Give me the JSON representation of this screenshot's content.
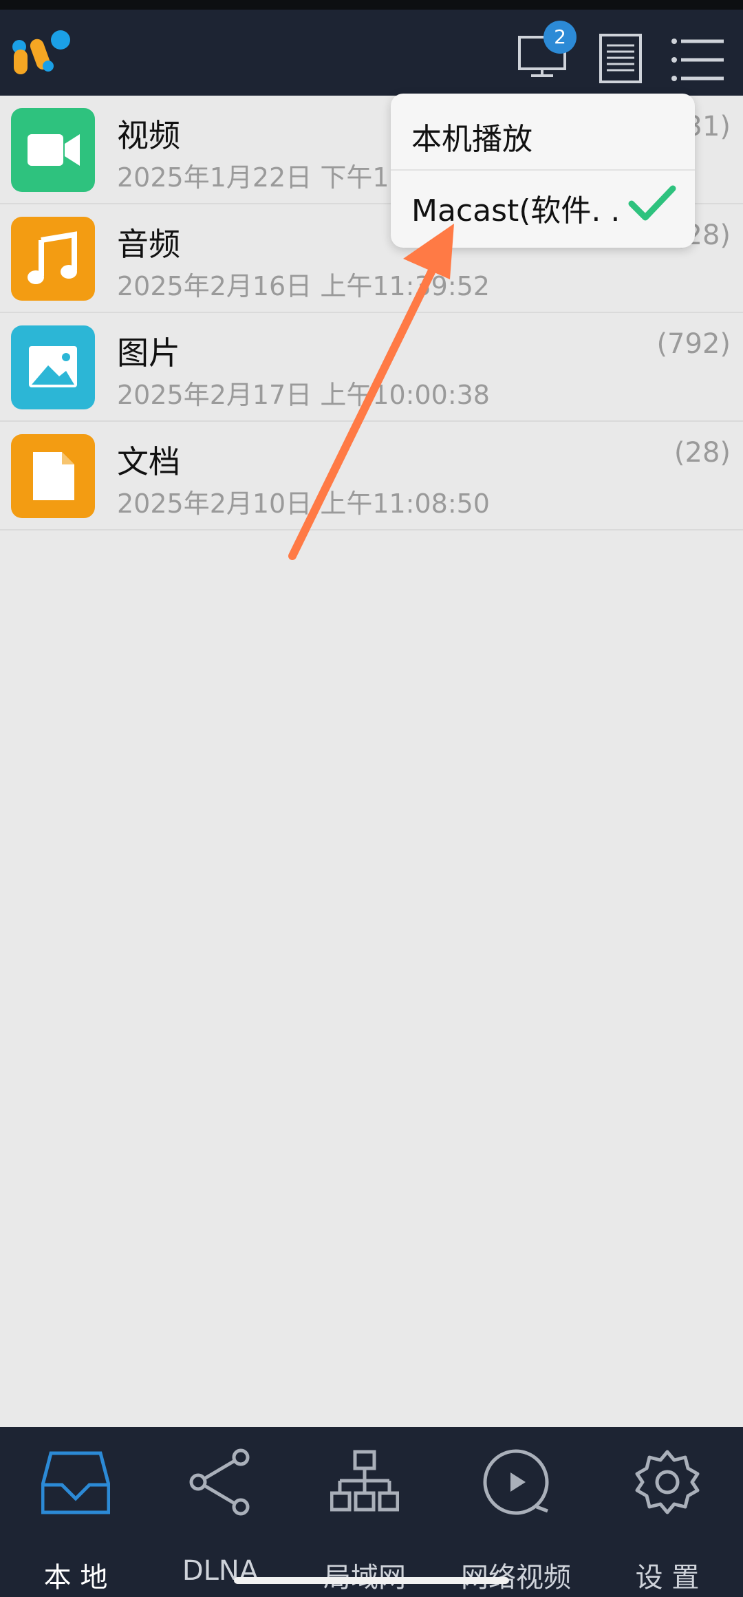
{
  "header": {
    "cast_badge": "2"
  },
  "categories": [
    {
      "name": "视频",
      "date": "2025年1月22日 下午10:07:18",
      "count": "(31)",
      "color": "#2ec27e",
      "icon": "video-camera-icon"
    },
    {
      "name": "音频",
      "date": "2025年2月16日 上午11:39:52",
      "count": "(28)",
      "color": "#f39c12",
      "icon": "music-note-icon"
    },
    {
      "name": "图片",
      "date": "2025年2月17日 上午10:00:38",
      "count": "(792)",
      "color": "#2cb6d6",
      "icon": "image-icon"
    },
    {
      "name": "文档",
      "date": "2025年2月10日 上午11:08:50",
      "count": "(28)",
      "color": "#f39c12",
      "icon": "document-icon"
    }
  ],
  "popup": {
    "option_local": "本机播放",
    "option_macast": "Macast(软件. .",
    "selected": "option_macast"
  },
  "tabs": [
    {
      "label": "本 地",
      "icon": "inbox-icon",
      "active": true
    },
    {
      "label": "DLNA",
      "icon": "share-icon",
      "active": false
    },
    {
      "label": "局域网",
      "icon": "network-icon",
      "active": false
    },
    {
      "label": "网络视频",
      "icon": "play-circle-icon",
      "active": false
    },
    {
      "label": "设 置",
      "icon": "gear-icon",
      "active": false
    }
  ],
  "colors": {
    "appbar": "#1d2433",
    "accent": "#2c8ad6",
    "check": "#2ec27e",
    "annotation_arrow": "#ff7a45"
  }
}
